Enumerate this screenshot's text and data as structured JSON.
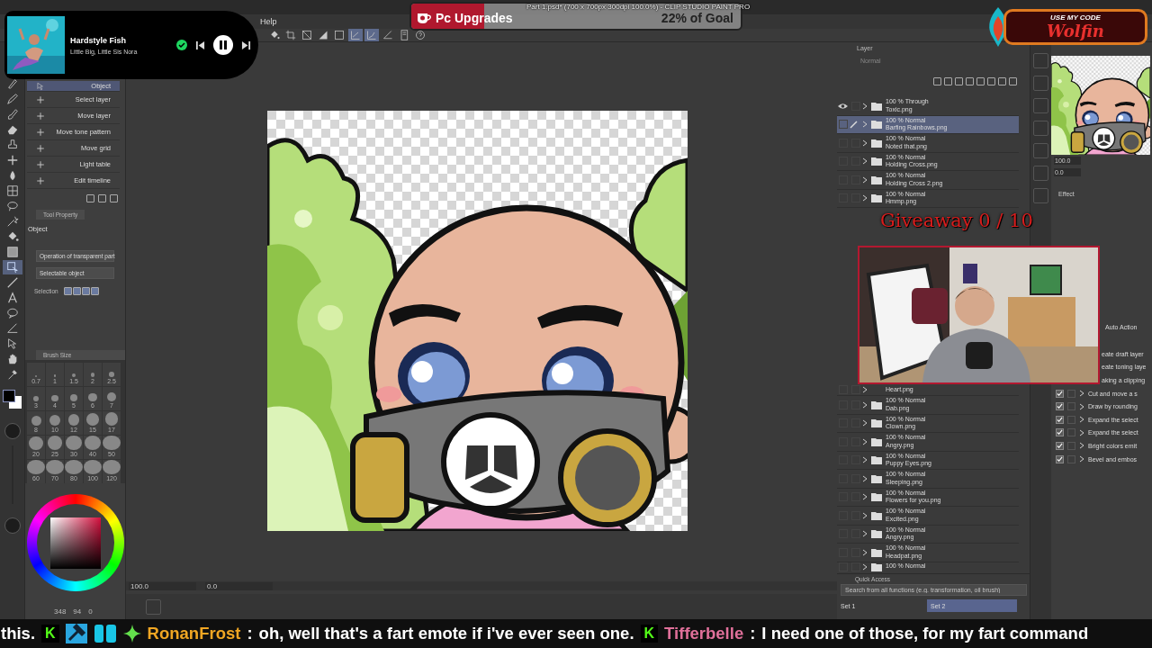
{
  "window": {
    "title": "Part 1.psd* (700 x 700px 300dpi 100.0%) - CLIP STUDIO PAINT PRO"
  },
  "menu": [
    "Help"
  ],
  "toolbar": [
    {
      "kind": "bucket",
      "selected": false
    },
    {
      "kind": "crop",
      "selected": false
    },
    {
      "kind": "slash",
      "selected": false
    },
    {
      "kind": "triangle",
      "selected": false
    },
    {
      "kind": "square",
      "selected": false
    },
    {
      "kind": "check",
      "selected": true
    },
    {
      "kind": "curve",
      "selected": true
    },
    {
      "kind": "ruler",
      "selected": false
    },
    {
      "kind": "panel",
      "selected": false
    },
    {
      "kind": "help",
      "selected": false
    }
  ],
  "music_player": {
    "title": "Hardstyle Fish",
    "artist": "Little Big, Little Sis Nora",
    "liked": true
  },
  "goal": {
    "name": "Pc Upgrades",
    "progress": "22% of Goal",
    "level": 0.22
  },
  "code_badge": {
    "caption": "USE MY CODE",
    "code": "Wolfin"
  },
  "tools": [
    {
      "kind": "pen",
      "selected": false
    },
    {
      "kind": "pencil",
      "selected": false
    },
    {
      "kind": "brush",
      "selected": false
    },
    {
      "kind": "eraser",
      "selected": false
    },
    {
      "kind": "stamp",
      "selected": false
    },
    {
      "kind": "sparkle",
      "selected": false
    },
    {
      "kind": "drop",
      "selected": false
    },
    {
      "kind": "grid",
      "selected": false
    },
    {
      "kind": "lasso",
      "selected": false
    },
    {
      "kind": "wand",
      "selected": false
    },
    {
      "kind": "bucket",
      "selected": false
    },
    {
      "kind": "gradient",
      "selected": false
    },
    {
      "kind": "object",
      "selected": true
    },
    {
      "kind": "line",
      "selected": false
    },
    {
      "kind": "text",
      "selected": false
    },
    {
      "kind": "balloon",
      "selected": false
    },
    {
      "kind": "ruler",
      "selected": false
    },
    {
      "kind": "arrow",
      "selected": false
    },
    {
      "kind": "hand",
      "selected": false
    },
    {
      "kind": "eyedropper",
      "selected": false
    }
  ],
  "sub_tools": [
    {
      "label": "Object",
      "selected": true
    },
    {
      "label": "Select layer",
      "selected": false
    },
    {
      "label": "Move layer",
      "selected": false
    },
    {
      "label": "Move tone pattern",
      "selected": false
    },
    {
      "label": "Move grid",
      "selected": false
    },
    {
      "label": "Light table",
      "selected": false
    },
    {
      "label": "Edit timeline",
      "selected": false
    }
  ],
  "tool_property": {
    "tab": "Tool Property",
    "title": "Object",
    "options": [
      "Operation of transparent part",
      "Selectable object"
    ],
    "selection_label": "Selection"
  },
  "brush_size": {
    "tab": "Brush Size",
    "sizes": [
      "0.7",
      "1",
      "1.5",
      "2",
      "2.5",
      "3",
      "4",
      "5",
      "6",
      "7",
      "8",
      "10",
      "12",
      "15",
      "17",
      "20",
      "25",
      "30",
      "40",
      "50",
      "60",
      "70",
      "80",
      "100",
      "120"
    ]
  },
  "color": {
    "readings": [
      "348",
      "94",
      "0"
    ]
  },
  "canvas_status": {
    "zoom": "100.0",
    "angle": "0.0"
  },
  "layer_panel": {
    "tab": "Layer",
    "blend": "Normal",
    "layers_top": [
      {
        "mode": "100 % Through",
        "name": "Toxic.png",
        "visible": true,
        "selected": false
      },
      {
        "mode": "100 % Normal",
        "name": "Barfing Rainbows.png",
        "visible": false,
        "selected": true
      },
      {
        "mode": "100 % Normal",
        "name": "Noted that.png",
        "visible": false,
        "selected": false
      },
      {
        "mode": "100 % Normal",
        "name": "Holding Cross.png",
        "visible": false,
        "selected": false
      },
      {
        "mode": "100 % Normal",
        "name": "Holding Cross 2.png",
        "visible": false,
        "selected": false
      },
      {
        "mode": "100 % Normal",
        "name": "Hmmp.png",
        "visible": false,
        "selected": false
      }
    ],
    "layers_bottom": [
      {
        "name": "Heart.png"
      },
      {
        "mode": "100 % Normal",
        "name": "Dab.png"
      },
      {
        "mode": "100 % Normal",
        "name": "Clown.png"
      },
      {
        "mode": "100 % Normal",
        "name": "Angry.png"
      },
      {
        "mode": "100 % Normal",
        "name": "Puppy Eyes.png"
      },
      {
        "mode": "100 % Normal",
        "name": "Sleeping.png"
      },
      {
        "mode": "100 % Normal",
        "name": "Flowers for you.png"
      },
      {
        "mode": "100 % Normal",
        "name": "Excited.png"
      },
      {
        "mode": "100 % Normal",
        "name": "Angry.png"
      },
      {
        "mode": "100 % Normal",
        "name": "Headpat.png"
      },
      {
        "mode": "100 % Normal"
      }
    ]
  },
  "navigator": {
    "zoom": "100.0",
    "angle": "0.0"
  },
  "effect_panel": {
    "title": "Effect"
  },
  "auto_action": {
    "title": "Auto Action",
    "items": [
      {
        "label": "eate draft layer"
      },
      {
        "label": "eate toning laye"
      },
      {
        "label": "aking a clipping"
      },
      {
        "label": "Cut and move a s",
        "checked": true
      },
      {
        "label": "Draw by rounding",
        "checked": true
      },
      {
        "label": "Expand the select",
        "checked": true
      },
      {
        "label": "Expand the select",
        "checked": true
      },
      {
        "label": "Bright colors emit",
        "checked": true
      },
      {
        "label": "Bevel and embos",
        "checked": true
      }
    ]
  },
  "quick_access": {
    "title": "Quick Access",
    "placeholder": "Search from all functions (e.g. transformation, oil brush)",
    "sets": [
      {
        "label": "Set 1",
        "selected": false
      },
      {
        "label": "Set 2",
        "selected": true
      }
    ]
  },
  "giveaway": {
    "text": "Giveaway 0 / 10"
  },
  "chat_ticker": [
    {
      "kind": "text",
      "text": "this."
    },
    {
      "kind": "badge",
      "text": "K"
    },
    {
      "kind": "emotes"
    },
    {
      "kind": "user",
      "text": "RonanFrost",
      "color": "#f0a623"
    },
    {
      "kind": "text",
      "text": ":"
    },
    {
      "kind": "text",
      "text": "oh, well that's a fart emote if i've ever seen one."
    },
    {
      "kind": "badge",
      "text": "K"
    },
    {
      "kind": "user",
      "text": "Tifferbelle",
      "color": "#e0709a"
    },
    {
      "kind": "text",
      "text": ":"
    },
    {
      "kind": "text",
      "text": "I need one of those, for my fart command"
    }
  ]
}
